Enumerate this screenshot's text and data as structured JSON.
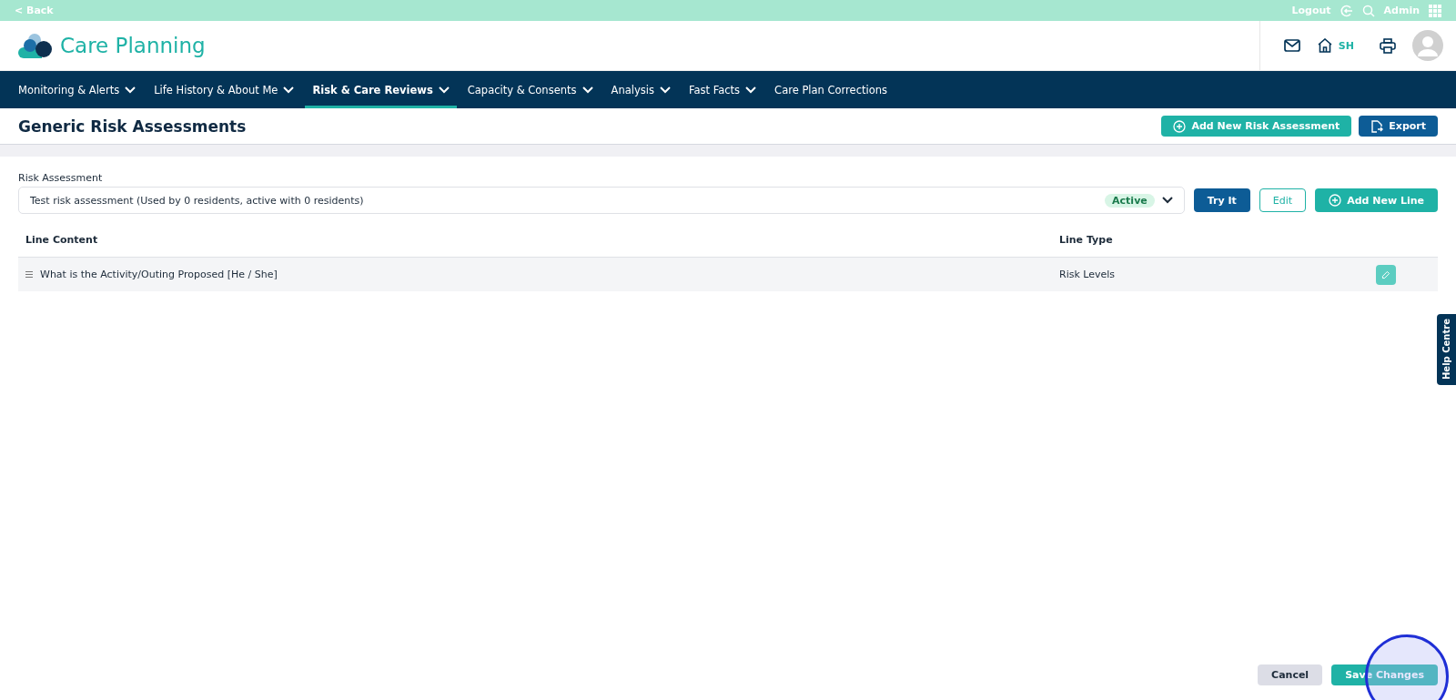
{
  "top_bar": {
    "back": "< Back",
    "logout": "Logout",
    "user": "Admin"
  },
  "header": {
    "app_title": "Care Planning",
    "home_code": "SH"
  },
  "nav": [
    {
      "label": "Monitoring & Alerts",
      "dropdown": true,
      "selected": false
    },
    {
      "label": "Life History & About Me",
      "dropdown": true,
      "selected": false
    },
    {
      "label": "Risk & Care Reviews",
      "dropdown": true,
      "selected": true
    },
    {
      "label": "Capacity & Consents",
      "dropdown": true,
      "selected": false
    },
    {
      "label": "Analysis",
      "dropdown": true,
      "selected": false
    },
    {
      "label": "Fast Facts",
      "dropdown": true,
      "selected": false
    },
    {
      "label": "Care Plan Corrections",
      "dropdown": false,
      "selected": false
    }
  ],
  "page": {
    "title": "Generic Risk Assessments",
    "actions": [
      {
        "label": "Add New Risk Assessment",
        "kind": "add"
      },
      {
        "label": "Export",
        "kind": "export"
      }
    ]
  },
  "selector": {
    "label": "Risk Assessment",
    "value": "Test risk assessment (Used by 0 residents, active with 0 residents)",
    "status": "Active",
    "buttons": [
      {
        "label": "Try It",
        "kind": "primary"
      },
      {
        "label": "Edit",
        "kind": "outline"
      },
      {
        "label": "Add New Line",
        "kind": "add"
      }
    ]
  },
  "table": {
    "columns": [
      "Line Content",
      "Line Type"
    ],
    "rows": [
      {
        "content": "What is the Activity/Outing Proposed [He / She]",
        "type": "Risk Levels"
      }
    ]
  },
  "help_tab": "Help Centre",
  "footer": {
    "buttons": [
      {
        "label": "Cancel",
        "kind": "secondary"
      },
      {
        "label": "Save Changes",
        "kind": "save"
      }
    ]
  }
}
